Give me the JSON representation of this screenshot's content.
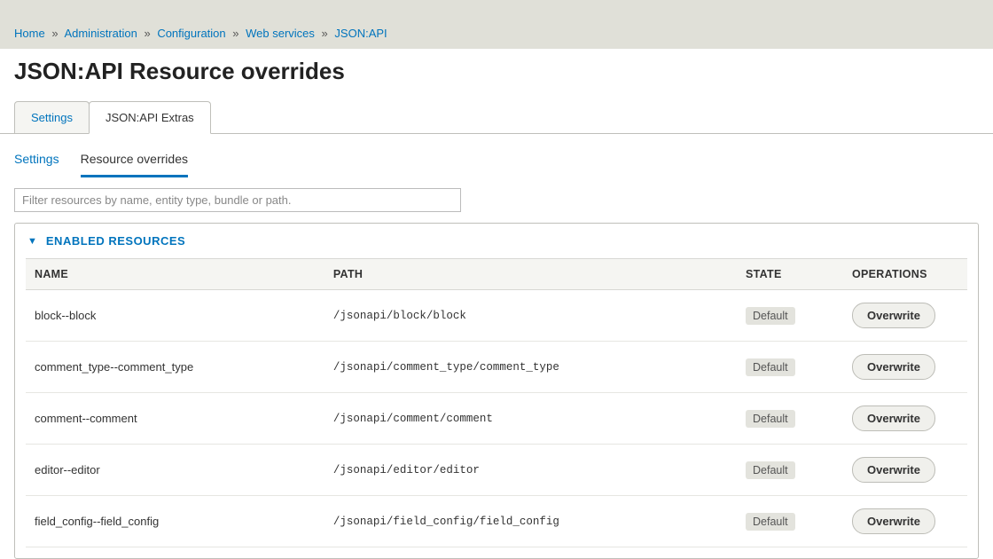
{
  "breadcrumb": [
    {
      "label": "Home"
    },
    {
      "label": "Administration"
    },
    {
      "label": "Configuration"
    },
    {
      "label": "Web services"
    },
    {
      "label": "JSON:API"
    }
  ],
  "page_title": "JSON:API Resource overrides",
  "primary_tabs": {
    "settings": "Settings",
    "extras": "JSON:API Extras"
  },
  "secondary_tabs": {
    "settings": "Settings",
    "overrides": "Resource overrides"
  },
  "filter_placeholder": "Filter resources by name, entity type, bundle or path.",
  "details_label": "ENABLED RESOURCES",
  "table": {
    "headers": {
      "name": "NAME",
      "path": "PATH",
      "state": "STATE",
      "operations": "OPERATIONS"
    },
    "rows": [
      {
        "name": "block--block",
        "path": "/jsonapi/block/block",
        "state": "Default",
        "op": "Overwrite"
      },
      {
        "name": "comment_type--comment_type",
        "path": "/jsonapi/comment_type/comment_type",
        "state": "Default",
        "op": "Overwrite"
      },
      {
        "name": "comment--comment",
        "path": "/jsonapi/comment/comment",
        "state": "Default",
        "op": "Overwrite"
      },
      {
        "name": "editor--editor",
        "path": "/jsonapi/editor/editor",
        "state": "Default",
        "op": "Overwrite"
      },
      {
        "name": "field_config--field_config",
        "path": "/jsonapi/field_config/field_config",
        "state": "Default",
        "op": "Overwrite"
      }
    ]
  }
}
